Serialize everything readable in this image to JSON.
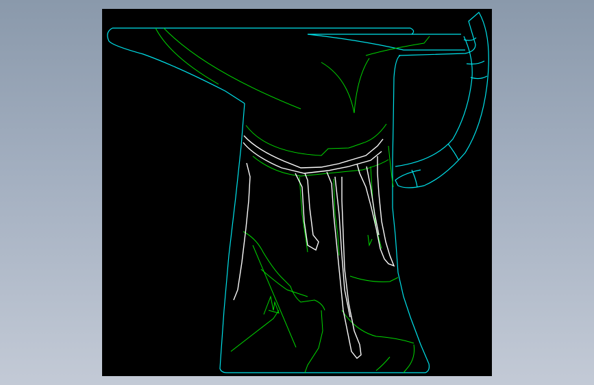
{
  "window": {
    "background_top": "#8a99ab",
    "background_bottom": "#c3cad6"
  },
  "viewport": {
    "background": "#000000"
  },
  "model": {
    "parts": [
      {
        "name": "jug-body-outline",
        "color": "#00e5ee"
      },
      {
        "name": "jug-handle",
        "color": "#00e5ee"
      },
      {
        "name": "jug-spout",
        "color": "#00e5ee"
      },
      {
        "name": "surface-detail-lines",
        "color": "#00dd00"
      },
      {
        "name": "drip-edges",
        "color": "#ffffff"
      }
    ]
  }
}
